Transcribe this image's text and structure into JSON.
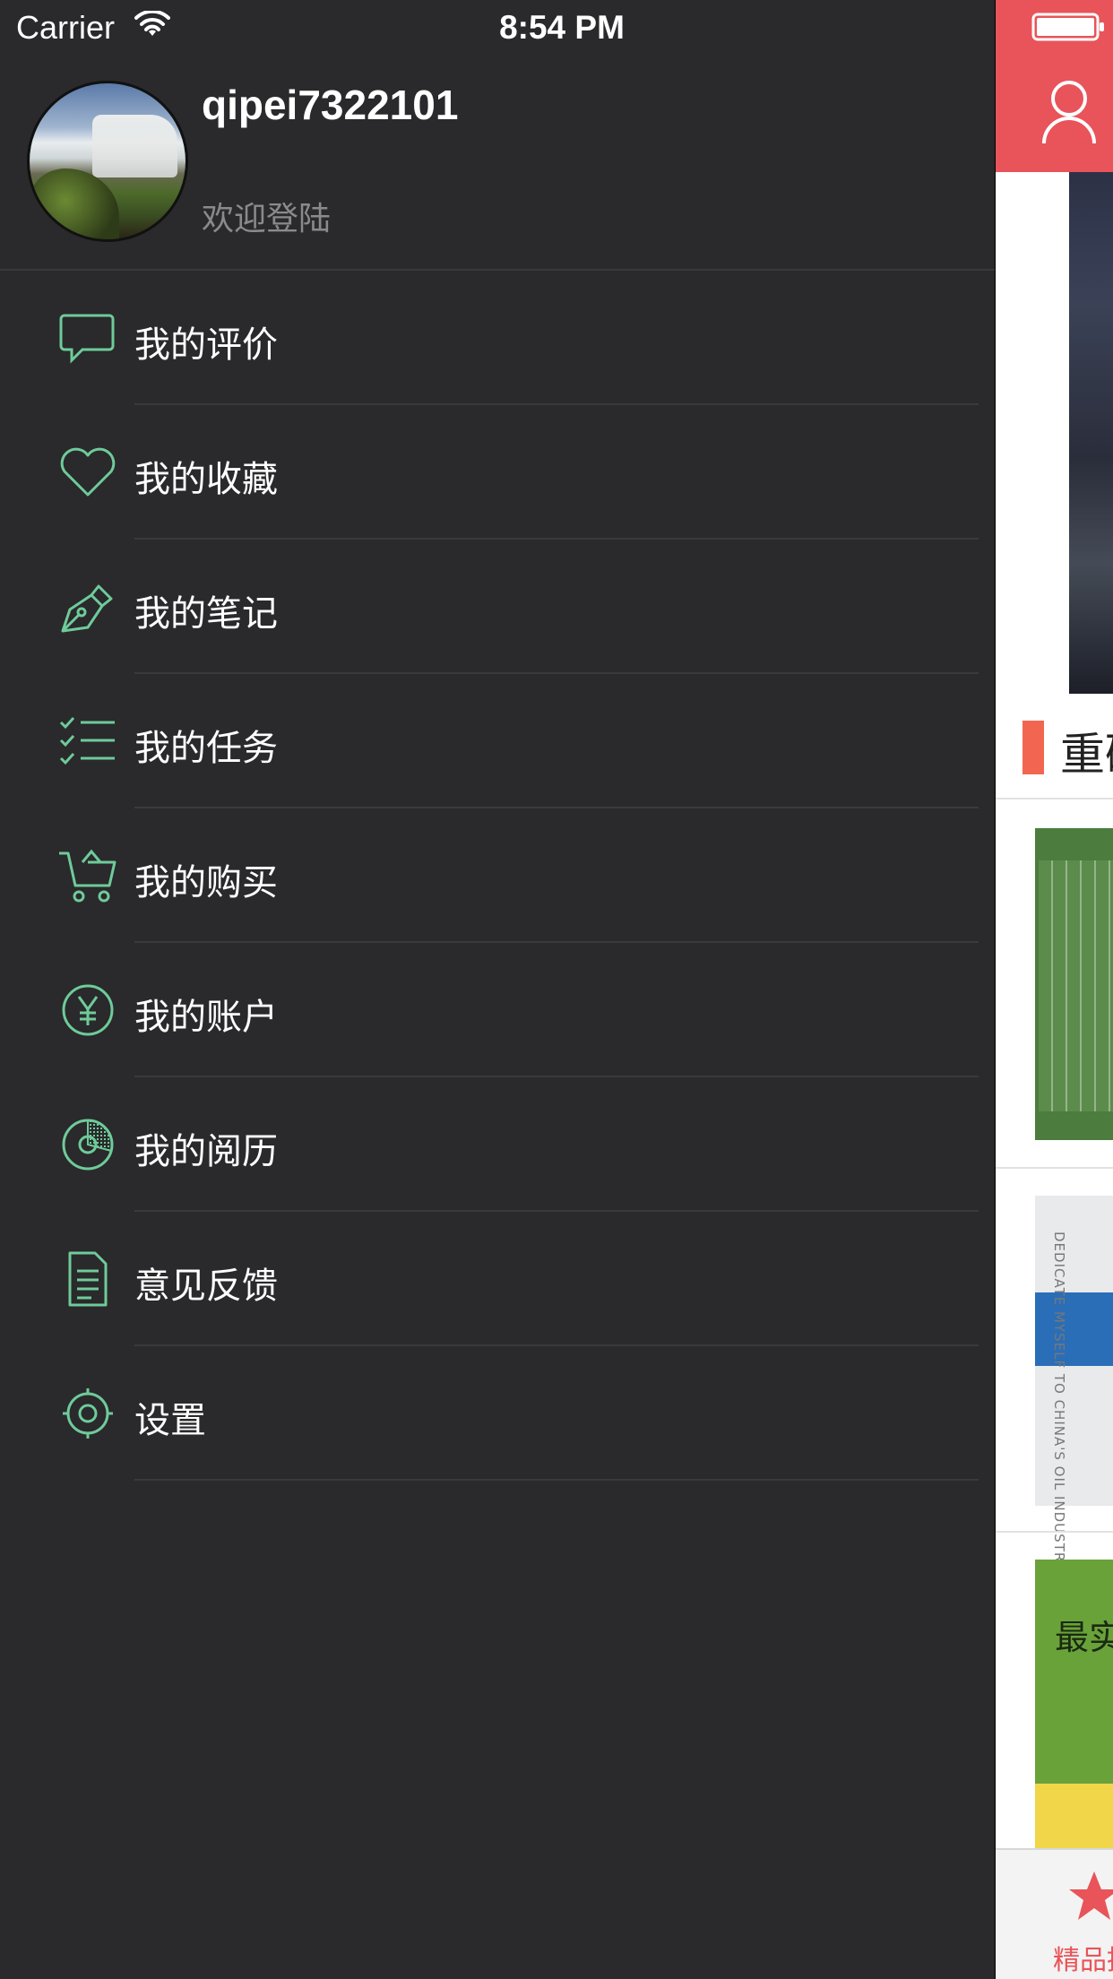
{
  "status_bar": {
    "carrier": "Carrier",
    "time": "8:54 PM"
  },
  "profile": {
    "username": "qipei7322101",
    "subtitle": "欢迎登陆"
  },
  "menu": [
    {
      "label": "我的评价",
      "icon": "comment-icon"
    },
    {
      "label": "我的收藏",
      "icon": "heart-icon"
    },
    {
      "label": "我的笔记",
      "icon": "pen-icon"
    },
    {
      "label": "我的任务",
      "icon": "checklist-icon"
    },
    {
      "label": "我的购买",
      "icon": "cart-icon"
    },
    {
      "label": "我的账户",
      "icon": "yen-icon"
    },
    {
      "label": "我的阅历",
      "icon": "pie-icon"
    },
    {
      "label": "意见反馈",
      "icon": "document-icon"
    },
    {
      "label": "设置",
      "icon": "settings-icon"
    }
  ],
  "peek": {
    "section_title": "重磅",
    "book2_spine": "DEDICATE MYSELF TO CHINA'S OIL INDUSTRY",
    "book3_title": "最实",
    "tab_label": "精品推"
  },
  "colors": {
    "background": "#2a292b",
    "icon_accent": "#6ecb9a",
    "header_red": "#e8545a",
    "section_bar": "#f26651"
  }
}
